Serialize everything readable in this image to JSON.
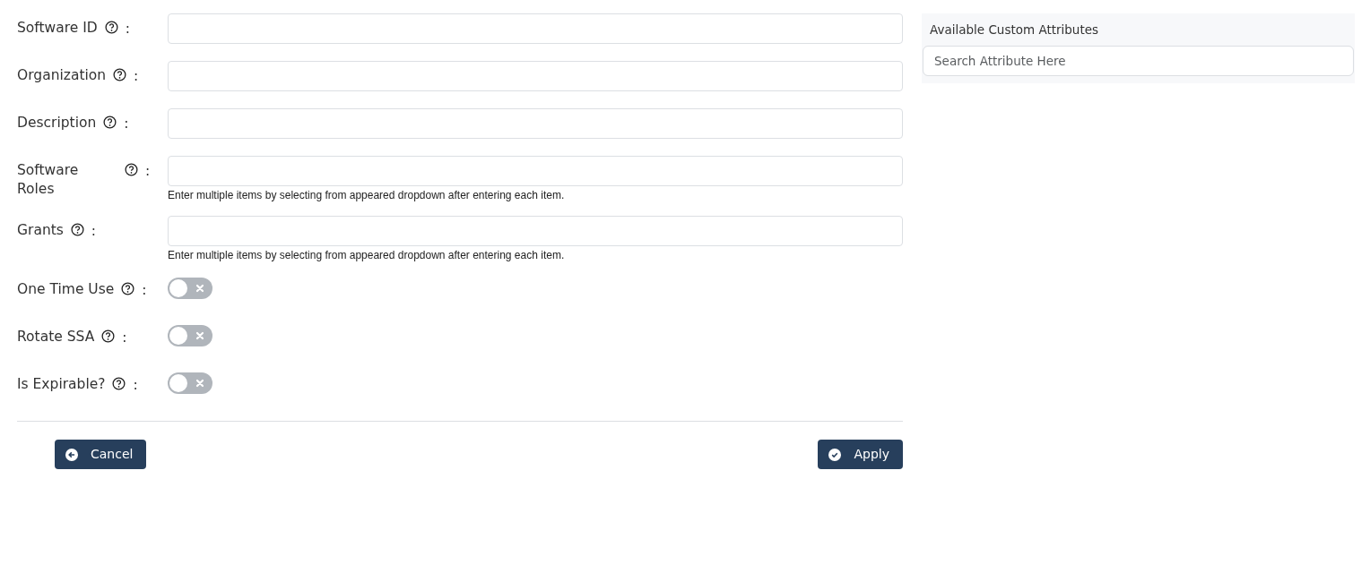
{
  "form": {
    "fields": [
      {
        "kind": "text",
        "label": "Software ID",
        "colon": ":"
      },
      {
        "kind": "text",
        "label": "Organization",
        "colon": ":"
      },
      {
        "kind": "text",
        "label": "Description",
        "colon": ":"
      },
      {
        "kind": "text",
        "label": "Software Roles",
        "colon": ":",
        "help": "Enter multiple items by selecting from appeared dropdown after entering each item."
      },
      {
        "kind": "text",
        "label": "Grants",
        "colon": ":",
        "help": "Enter multiple items by selecting from appeared dropdown after entering each item."
      },
      {
        "kind": "toggle",
        "label": "One Time Use",
        "colon": ":",
        "on": false
      },
      {
        "kind": "toggle",
        "label": "Rotate SSA",
        "colon": ":",
        "on": false
      },
      {
        "kind": "toggle",
        "label": "Is Expirable?",
        "colon": ":",
        "on": false
      }
    ],
    "buttons": [
      {
        "kind": "cancel",
        "label": "Cancel"
      },
      {
        "kind": "apply",
        "label": "Apply"
      }
    ]
  },
  "attributes_panel": {
    "title": "Available Custom Attributes",
    "search": {
      "placeholder": "Search Attribute Here"
    }
  }
}
